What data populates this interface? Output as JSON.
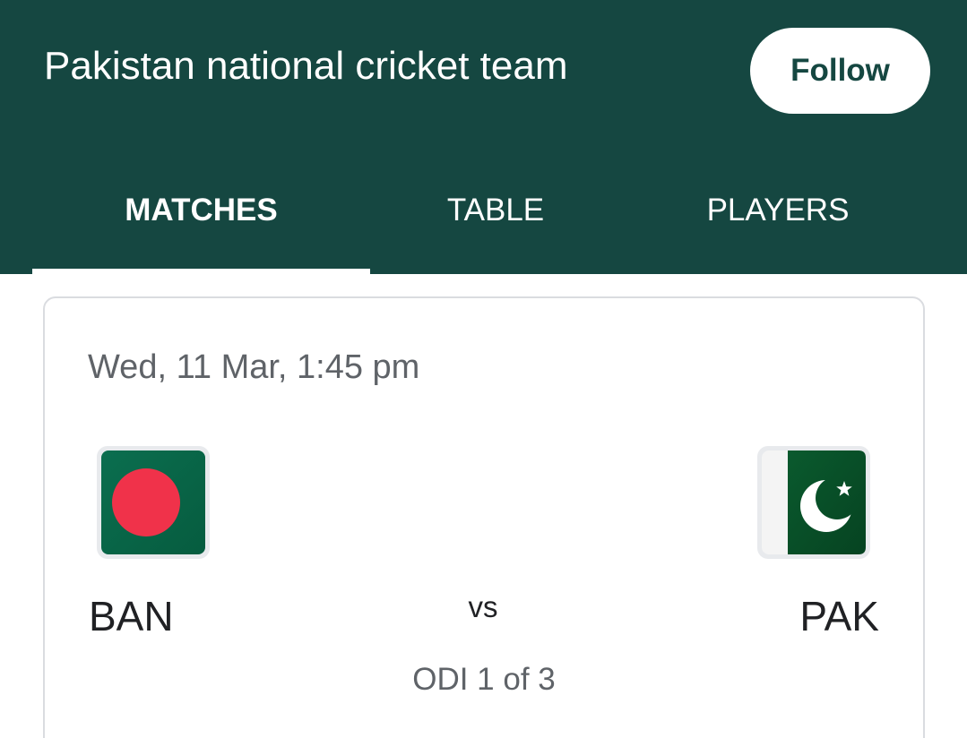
{
  "header": {
    "title": "Pakistan national cricket team",
    "follow_label": "Follow",
    "background_color": "#154741"
  },
  "tabs": [
    {
      "label": "MATCHES",
      "active": true
    },
    {
      "label": "TABLE",
      "active": false
    },
    {
      "label": "PLAYERS",
      "active": false
    }
  ],
  "match": {
    "datetime": "Wed, 11 Mar, 1:45 pm",
    "home": {
      "code": "BAN",
      "flag_icon": "bangladesh-flag-icon"
    },
    "away": {
      "code": "PAK",
      "flag_icon": "pakistan-flag-icon"
    },
    "vs_label": "vs",
    "series": "ODI 1 of 3"
  }
}
